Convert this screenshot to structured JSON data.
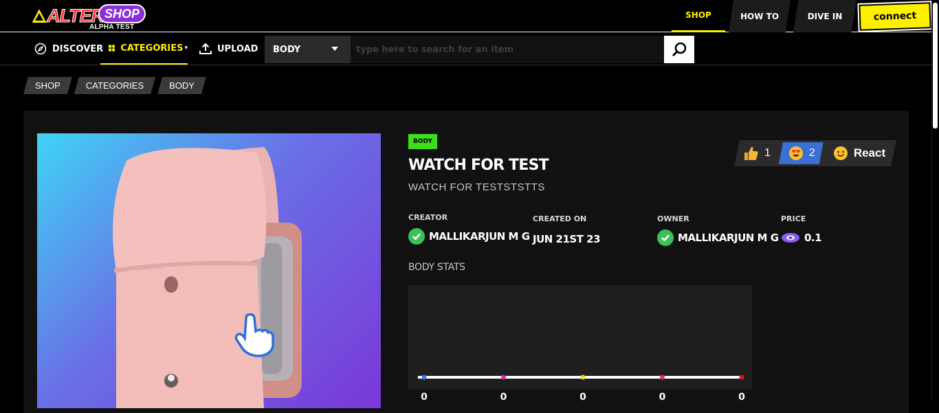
{
  "brand": {
    "name": "ALTER",
    "shop": "SHOP",
    "tag": "ALPHA TEST"
  },
  "topnav": {
    "shop": "SHOP",
    "howto": "HOW TO",
    "divein": "DIVE IN",
    "connect": "connect"
  },
  "subnav": {
    "discover": "DISCOVER",
    "categories": "CATEGORIES",
    "upload": "UPLOAD",
    "dropdown_value": "BODY",
    "search_placeholder": "type here to search for an item"
  },
  "breadcrumb": [
    "SHOP",
    "CATEGORIES",
    "BODY"
  ],
  "product": {
    "badge": "BODY",
    "title": "WATCH FOR TEST",
    "subtitle": "WATCH FOR TESTSTSTTS",
    "creator_label": "CREATOR",
    "creator": "MALLIKARJUN M G",
    "created_label": "CREATED ON",
    "created": "JUN 21ST 23",
    "owner_label": "OWNER",
    "owner": "MALLIKARJUN M G",
    "price_label": "PRICE",
    "price": "0.1",
    "stats_label": "BODY STATS"
  },
  "reactions": {
    "like_count": "1",
    "love_count": "2",
    "react_label": "React"
  },
  "stats": {
    "values": [
      "0",
      "0",
      "0",
      "0",
      "0"
    ],
    "dot_colors": [
      "#3a7bff",
      "#e62ba1",
      "#e8e01c",
      "#e62b7d",
      "#e01414"
    ]
  }
}
